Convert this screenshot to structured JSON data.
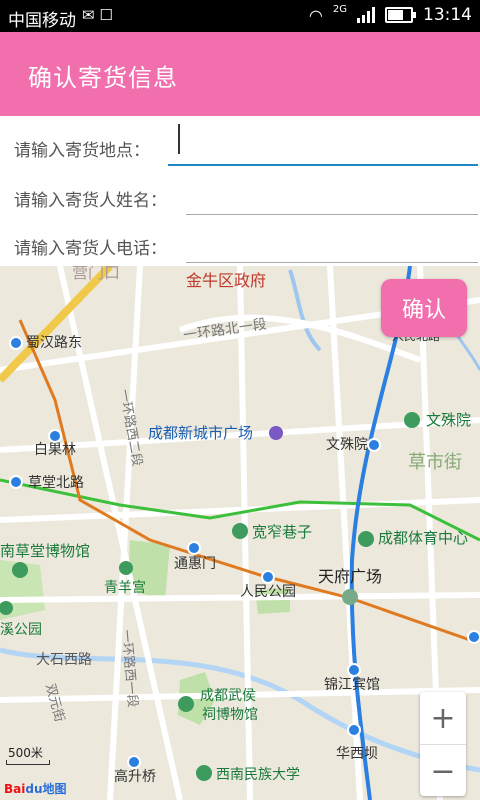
{
  "status": {
    "carrier": "中国移动",
    "net_label": "2G",
    "time": "13:14",
    "battery_level": 0.75
  },
  "appbar": {
    "title": "确认寄货信息"
  },
  "form": {
    "location_label": "请输入寄货地点：",
    "name_label": "请输入寄货人姓名：",
    "phone_label": "请输入寄货人电话：",
    "location_value": "",
    "name_value": "",
    "phone_value": ""
  },
  "confirm_label": "确认",
  "map": {
    "labels": {
      "jinniu": "金牛区政府",
      "shuhan": "蜀汉路东",
      "yihuan_north": "一环路北一段",
      "chengdu_new_city": "成都新城市广场",
      "wenshuyuan_station": "文殊院",
      "wenshuyuan_poi": "文殊院",
      "caoshi": "草市街",
      "baiguolin": "白果林",
      "caotang_north": "草堂北路",
      "kuanzhai": "宽窄巷子",
      "sports_center": "成都体育中心",
      "caotang_museum": "南草堂博物馆",
      "tonghuimen": "通惠门",
      "tianfu_square": "天府广场",
      "qingyang": "青羊宫",
      "peoples_park": "人民公园",
      "xi_park": "溪公园",
      "dashixi": "大石西路",
      "yihuan_west": "一环路西二段",
      "yihuan_west1": "一环路西一段",
      "shuangyuan": "双元街",
      "jinjiang_hotel": "锦江宾馆",
      "wuhou_museum_1": "成都武侯",
      "wuhou_museum_2": "祠博物馆",
      "huaxiba": "华西坝",
      "gaoshengqiao": "高升桥",
      "minzu_univ": "西南民族大学",
      "top_partial": "营门口",
      "right_partial": "人民北路"
    },
    "scale": "500米",
    "logo_bai": "Bai",
    "logo_du": "du",
    "logo_map": "地图",
    "zoom_in": "+",
    "zoom_out": "−"
  }
}
